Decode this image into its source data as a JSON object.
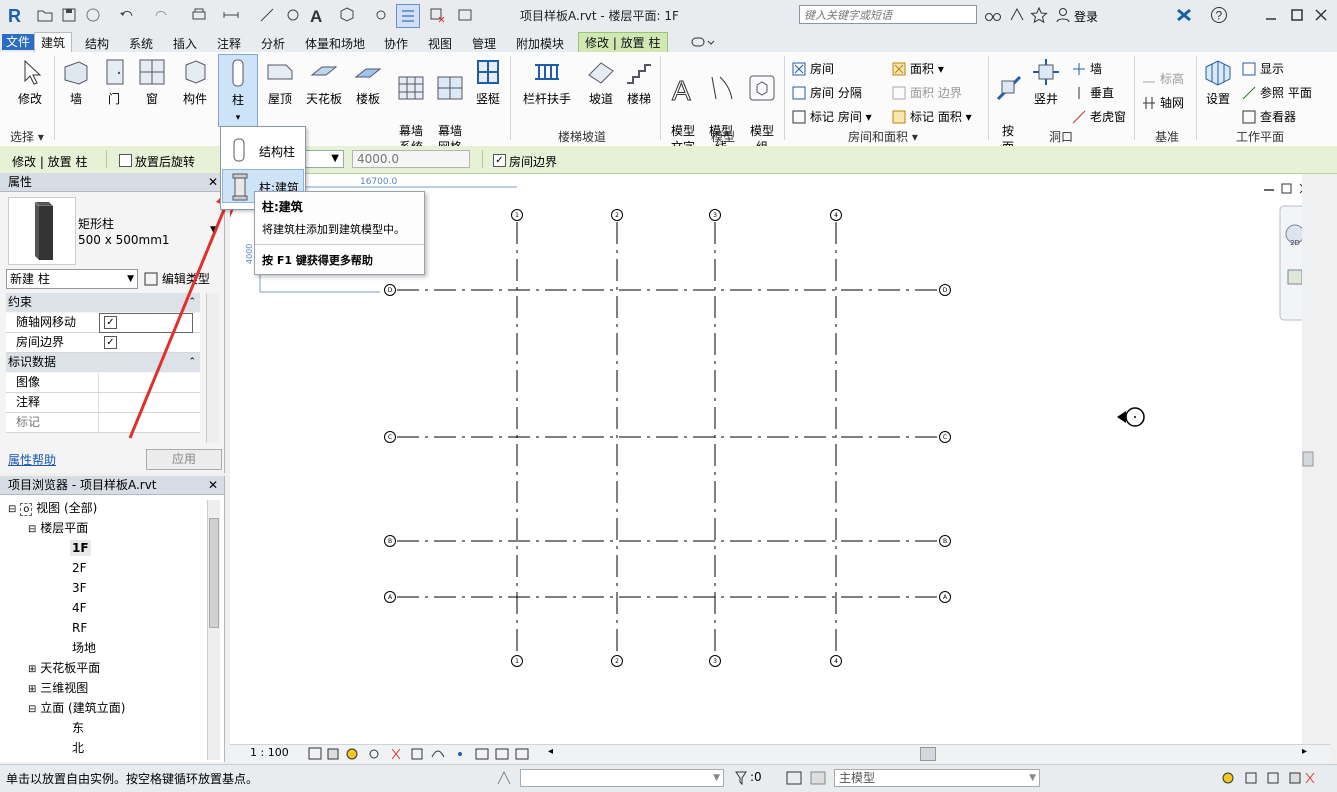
{
  "window": {
    "title": "项目样板A.rvt - 楼层平面: 1F",
    "search_placeholder": "键入关键字或短语",
    "login_label": "登录",
    "help_label": "?"
  },
  "tabs": [
    "文件",
    "建筑",
    "结构",
    "系统",
    "插入",
    "注释",
    "分析",
    "体量和场地",
    "协作",
    "视图",
    "管理",
    "附加模块",
    "修改 | 放置 柱"
  ],
  "ribbon": {
    "select": {
      "label": "修改",
      "panel": "选择"
    },
    "build": {
      "items": [
        "墙",
        "门",
        "窗",
        "构件",
        "柱",
        "屋顶",
        "天花板",
        "楼板",
        "幕墙\n系统",
        "幕墙\n网格",
        "竖梃"
      ]
    },
    "circulation": {
      "items": [
        "栏杆扶手",
        "坡道",
        "楼梯"
      ],
      "panel": "楼梯坡道"
    },
    "model": {
      "items": [
        "模型\n文字",
        "模型\n线",
        "模型\n组"
      ],
      "panel": "模型"
    },
    "room_area": {
      "items": [
        "房间",
        "房间 分隔",
        "标记 房间",
        "面积",
        "面积 边界",
        "标记 面积"
      ],
      "panel": "房间和面积"
    },
    "opening": {
      "items": [
        "按\n面",
        "竖井",
        "墙",
        "垂直",
        "老虎窗"
      ],
      "panel": "洞口"
    },
    "datum": {
      "items": [
        "标高",
        "轴网"
      ],
      "panel": "基准"
    },
    "workplane": {
      "items": [
        "设置",
        "显示",
        "参照 平面",
        "查看器"
      ],
      "panel": "工作平面"
    }
  },
  "options_bar": {
    "context": "修改 | 放置 柱",
    "rotate_label": "放置后旋转",
    "height_value": "4000.0",
    "room_bound_label": "房间边界"
  },
  "column_dropdown": {
    "items": [
      "结构柱",
      "柱:建筑"
    ]
  },
  "tooltip": {
    "title": "柱:建筑",
    "desc": "将建筑柱添加到建筑模型中。",
    "help": "按 F1 键获得更多帮助"
  },
  "properties": {
    "header": "属性",
    "type_name": "矩形柱",
    "type_size": "500 x 500mm1",
    "new_instance": "新建 柱",
    "edit_type": "编辑类型",
    "categories": [
      {
        "name": "约束",
        "rows": [
          {
            "label": "随轴网移动",
            "checked": true
          },
          {
            "label": "房间边界",
            "checked": true
          }
        ]
      },
      {
        "name": "标识数据",
        "rows": [
          {
            "label": "图像"
          },
          {
            "label": "注释"
          },
          {
            "label": "标记"
          }
        ]
      }
    ],
    "help_link": "属性帮助",
    "apply": "应用"
  },
  "project_browser": {
    "header": "项目浏览器 - 项目样板A.rvt",
    "tree": [
      {
        "text": "视图 (全部)",
        "level": 0
      },
      {
        "text": "楼层平面",
        "level": 1
      },
      {
        "text": "1F",
        "level": 2
      },
      {
        "text": "2F",
        "level": 2
      },
      {
        "text": "3F",
        "level": 2
      },
      {
        "text": "4F",
        "level": 2
      },
      {
        "text": "RF",
        "level": 2
      },
      {
        "text": "场地",
        "level": 2
      },
      {
        "text": "天花板平面",
        "level": 1
      },
      {
        "text": "三维视图",
        "level": 1
      },
      {
        "text": "立面 (建筑立面)",
        "level": 1
      },
      {
        "text": "东",
        "level": 2
      },
      {
        "text": "北",
        "level": 2
      }
    ]
  },
  "canvas": {
    "dimension_label": "16700.0",
    "vertical_dim": "4000",
    "grid_bubbles_vertical": [
      "1",
      "2",
      "3",
      "4"
    ],
    "grid_bubbles_horizontal": [
      "D",
      "C",
      "B",
      "A"
    ]
  },
  "view_control": {
    "scale": "1 : 100"
  },
  "status": {
    "message": "单击以放置自由实例。按空格键循环放置基点。",
    "count": ":0",
    "model": "主模型"
  },
  "colors": {
    "file_tab": "#2b6cc4",
    "context_tab": "#cfe8b4",
    "arrow": "#e0302b"
  }
}
